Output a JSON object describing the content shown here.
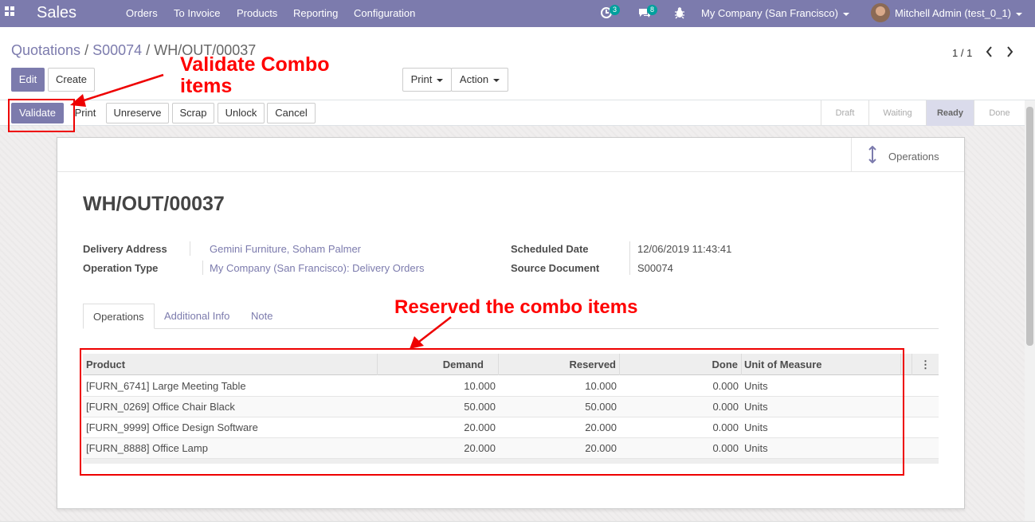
{
  "navbar": {
    "app_name": "Sales",
    "menu": [
      "Orders",
      "To Invoice",
      "Products",
      "Reporting",
      "Configuration"
    ],
    "activity_count": "3",
    "message_count": "8",
    "company": "My Company (San Francisco)",
    "user": "Mitchell Admin (test_0_1)"
  },
  "breadcrumb": {
    "part1": "Quotations",
    "sep1": "/",
    "part2": "S00074",
    "sep2": "/",
    "current": "WH/OUT/00037"
  },
  "control": {
    "edit": "Edit",
    "create": "Create",
    "print": "Print",
    "action": "Action",
    "pager": "1 / 1",
    "prev": "‹",
    "next": "›"
  },
  "header_buttons": {
    "validate": "Validate",
    "print": "Print",
    "unreserve": "Unreserve",
    "scrap": "Scrap",
    "unlock": "Unlock",
    "cancel": "Cancel"
  },
  "statusbar": [
    "Draft",
    "Waiting",
    "Ready",
    "Done"
  ],
  "statusbar_active": "Ready",
  "smart_button": {
    "label": "Operations"
  },
  "record": {
    "name": "WH/OUT/00037",
    "delivery_address_label": "Delivery Address",
    "delivery_address": "Gemini Furniture, Soham Palmer",
    "operation_type_label": "Operation Type",
    "operation_type": "My Company (San Francisco): Delivery Orders",
    "scheduled_date_label": "Scheduled Date",
    "scheduled_date": "12/06/2019 11:43:41",
    "source_document_label": "Source Document",
    "source_document": "S00074"
  },
  "tabs": [
    "Operations",
    "Additional Info",
    "Note"
  ],
  "table": {
    "headers": {
      "product": "Product",
      "demand": "Demand",
      "reserved": "Reserved",
      "done": "Done",
      "uom": "Unit of Measure"
    },
    "rows": [
      {
        "product": "[FURN_6741] Large Meeting Table",
        "demand": "10.000",
        "reserved": "10.000",
        "done": "0.000",
        "uom": "Units"
      },
      {
        "product": "[FURN_0269] Office Chair Black",
        "demand": "50.000",
        "reserved": "50.000",
        "done": "0.000",
        "uom": "Units"
      },
      {
        "product": "[FURN_9999] Office Design Software",
        "demand": "20.000",
        "reserved": "20.000",
        "done": "0.000",
        "uom": "Units"
      },
      {
        "product": "[FURN_8888] Office Lamp",
        "demand": "20.000",
        "reserved": "20.000",
        "done": "0.000",
        "uom": "Units"
      }
    ]
  },
  "annotations": {
    "validate_line1": "Validate Combo",
    "validate_line2": "items",
    "reserved": "Reserved the combo items"
  },
  "colors": {
    "primary": "#7c7bad",
    "annotation": "#ff0000"
  }
}
